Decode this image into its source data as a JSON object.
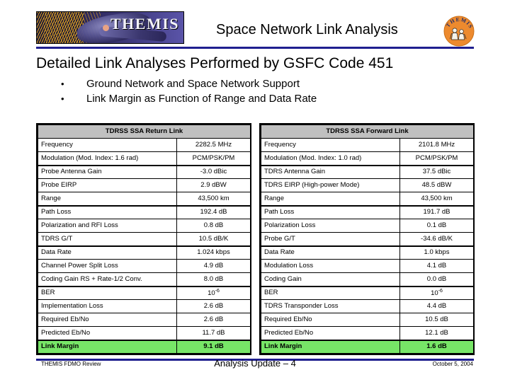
{
  "header": {
    "title": "Space Network Link Analysis",
    "logo_text": "THEMIS",
    "logo_alt": "themis-banner-logo",
    "seal_alt": "themis-circular-seal",
    "seal_arc_text": "THEMIS"
  },
  "subtitle": "Detailed Link Analyses Performed by GSFC Code 451",
  "bullets": [
    {
      "mark": "•",
      "text": "Ground Network and Space Network Support"
    },
    {
      "mark": "•",
      "text": "Link Margin as Function of Range and Data Rate"
    }
  ],
  "colors": {
    "rule": "#1f1f8f",
    "header_cell": "#c0c0c0",
    "link_margin_highlight": "#77e567"
  },
  "tables": {
    "left": {
      "title": "TDRSS SSA Return Link",
      "rows": [
        {
          "label": "Frequency",
          "value": "2282.5 MHz",
          "group_top": false
        },
        {
          "label": "Modulation (Mod. Index: 1.6 rad)",
          "value": "PCM/PSK/PM",
          "group_top": false
        },
        {
          "label": "Probe Antenna Gain",
          "value": "-3.0 dBic",
          "group_top": true
        },
        {
          "label": "Probe EIRP",
          "value": "2.9 dBW",
          "group_top": false
        },
        {
          "label": "Range",
          "value": "43,500 km",
          "group_top": false
        },
        {
          "label": "Path Loss",
          "value": "192.4 dB",
          "group_top": true
        },
        {
          "label": "Polarization and RFI Loss",
          "value": "0.8 dB",
          "group_top": false
        },
        {
          "label": "TDRS G/T",
          "value": "10.5 dB/K",
          "group_top": false
        },
        {
          "label": "Data Rate",
          "value": "1.024 kbps",
          "group_top": true
        },
        {
          "label": "Channel Power Split Loss",
          "value": "4.9 dB",
          "group_top": false
        },
        {
          "label": "Coding Gain RS + Rate-1/2 Conv.",
          "value": "8.0 dB",
          "group_top": false
        },
        {
          "label": "BER",
          "value": "10-6",
          "value_base": "10",
          "value_sup": "-6",
          "group_top": true
        },
        {
          "label": "Implementation Loss",
          "value": "2.6 dB",
          "group_top": false
        },
        {
          "label": "Required Eb/No",
          "value": "2.6 dB",
          "group_top": false
        },
        {
          "label": "Predicted Eb/No",
          "value": "11.7 dB",
          "group_top": false
        }
      ],
      "margin_row": {
        "label": "Link Margin",
        "value": "9.1 dB"
      }
    },
    "right": {
      "title": "TDRSS SSA Forward Link",
      "rows": [
        {
          "label": "Frequency",
          "value": "2101.8 MHz",
          "group_top": false
        },
        {
          "label": "Modulation (Mod. Index: 1.0 rad)",
          "value": "PCM/PSK/PM",
          "group_top": false
        },
        {
          "label": "TDRS Antenna Gain",
          "value": "37.5 dBic",
          "group_top": true
        },
        {
          "label": "TDRS EIRP (High-power Mode)",
          "value": "48.5 dBW",
          "group_top": false
        },
        {
          "label": "Range",
          "value": "43,500 km",
          "group_top": false
        },
        {
          "label": "Path Loss",
          "value": "191.7 dB",
          "group_top": true
        },
        {
          "label": "Polarization Loss",
          "value": "0.1 dB",
          "group_top": false
        },
        {
          "label": "Probe G/T",
          "value": "-34.6 dB/K",
          "group_top": false
        },
        {
          "label": "Data Rate",
          "value": "1.0 kbps",
          "group_top": true
        },
        {
          "label": "Modulation Loss",
          "value": "4.1 dB",
          "group_top": false
        },
        {
          "label": "Coding Gain",
          "value": "0.0 dB",
          "group_top": false
        },
        {
          "label": "BER",
          "value": "10-6",
          "value_base": "10",
          "value_sup": "-6",
          "group_top": true
        },
        {
          "label": "TDRS Transponder Loss",
          "value": "4.4 dB",
          "group_top": false
        },
        {
          "label": "Required Eb/No",
          "value": "10.5 dB",
          "group_top": false
        },
        {
          "label": "Predicted Eb/No",
          "value": "12.1 dB",
          "group_top": false
        }
      ],
      "margin_row": {
        "label": "Link Margin",
        "value": "1.6 dB"
      }
    }
  },
  "footer": {
    "left": "THEMIS FDMO Review",
    "center": "Analysis Update – 4",
    "right": "October 5, 2004"
  }
}
